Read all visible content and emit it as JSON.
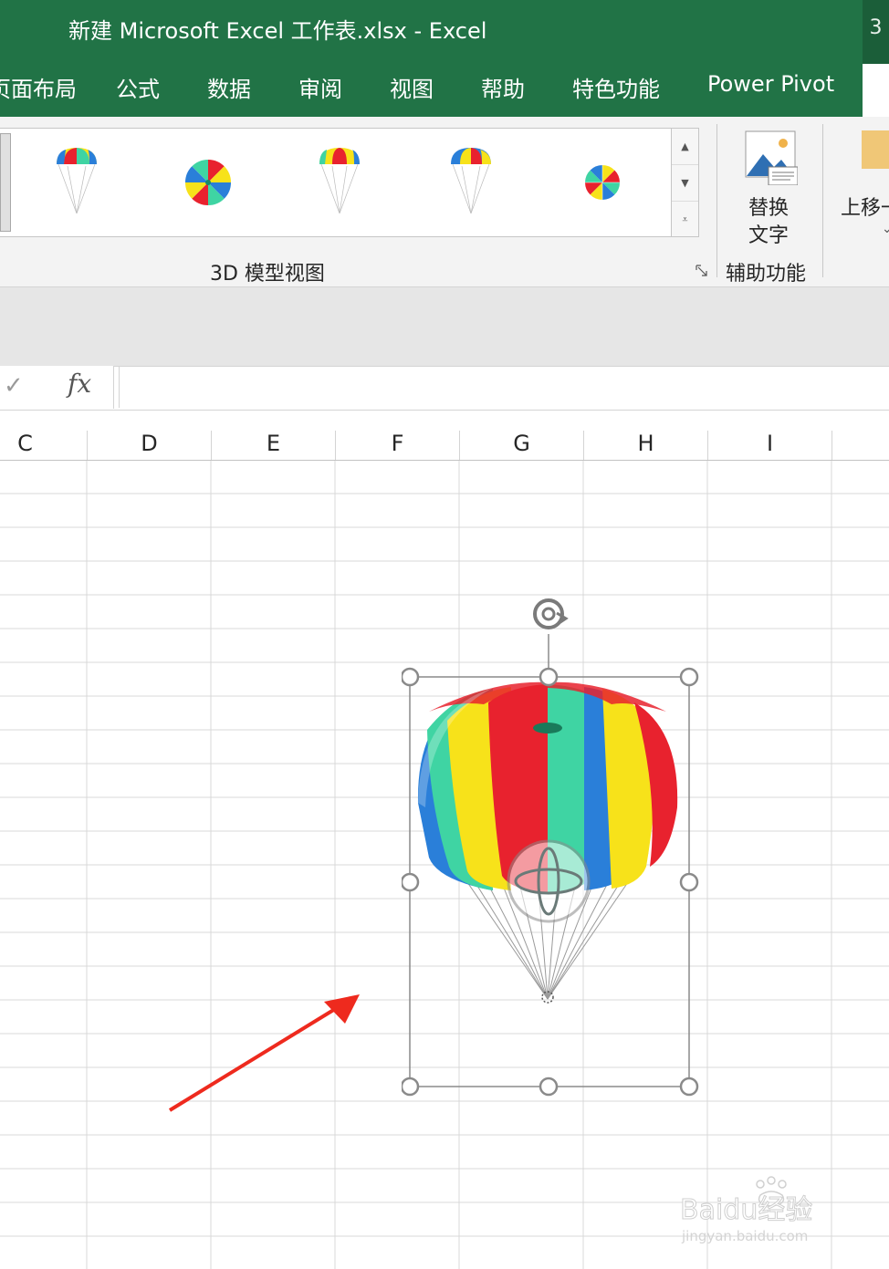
{
  "window": {
    "title": "新建 Microsoft Excel 工作表.xlsx  -  Excel",
    "badge": "3"
  },
  "tabs": [
    "页面布局",
    "公式",
    "数据",
    "审阅",
    "视图",
    "帮助",
    "特色功能",
    "Power Pivot"
  ],
  "ribbon": {
    "gallery_group_label": "3D 模型视图",
    "alt_text_label_line1": "替换",
    "alt_text_label_line2": "文字",
    "accessibility_group_label": "辅助功能",
    "bring_forward_label": "上移一",
    "colors": {
      "tab_bar": "#217346",
      "ribbon_bg": "#f3f3f3"
    }
  },
  "formula_bar": {
    "enter_icon": "check-icon",
    "fx_label": "fx",
    "value": ""
  },
  "sheet": {
    "columns": [
      "C",
      "D",
      "E",
      "F",
      "G",
      "H",
      "I"
    ]
  },
  "model": {
    "name": "parachute-3d-model",
    "colors": [
      "#e8222e",
      "#f7e21a",
      "#2a7fd9",
      "#3fd4a3"
    ]
  },
  "annotation": {
    "arrow_color": "#ee2a1e"
  },
  "watermark": {
    "text_line1": "Baidu经验",
    "text_line2": "jingyan.baidu.com"
  }
}
